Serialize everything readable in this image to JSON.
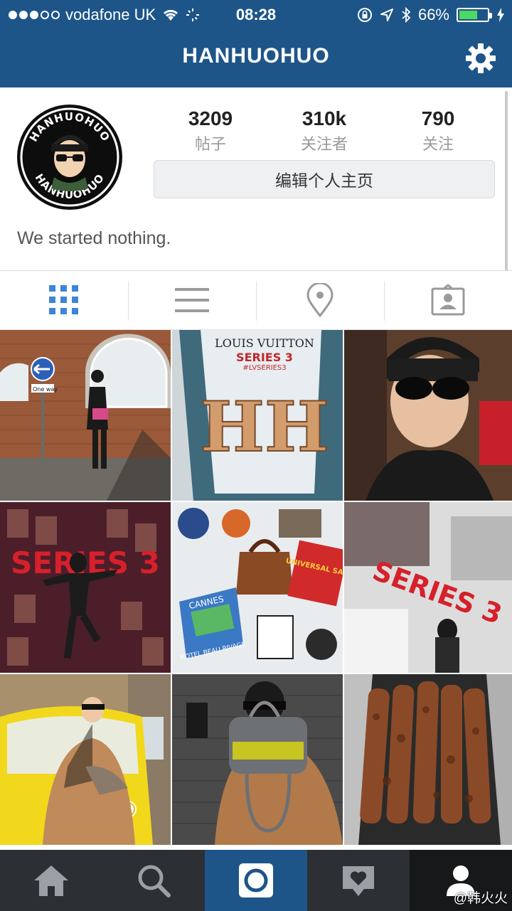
{
  "status_bar": {
    "carrier": "vodafone UK",
    "time": "08:28",
    "battery_pct": "66%",
    "battery_level": 0.66,
    "signal_dots_filled": 3,
    "signal_dots_total": 5
  },
  "header": {
    "title": "HANHUOHUO",
    "accent": "#1d5589"
  },
  "profile": {
    "avatar_text_top": "HANHUOHUO",
    "avatar_text_bottom": "HANHUOHUO",
    "stats": [
      {
        "value": "3209",
        "label": "帖子"
      },
      {
        "value": "310k",
        "label": "关注者"
      },
      {
        "value": "790",
        "label": "关注"
      }
    ],
    "edit_button": "编辑个人主页",
    "bio": "We started nothing."
  },
  "tabs": [
    {
      "icon": "grid-icon",
      "active": true
    },
    {
      "icon": "list-icon",
      "active": false
    },
    {
      "icon": "location-pin-icon",
      "active": false
    },
    {
      "icon": "tagged-photos-icon",
      "active": false
    }
  ],
  "grid": {
    "photos": [
      {
        "caption": "",
        "sign": "One way"
      },
      {
        "caption": "LOUIS VUITTON",
        "sub": "SERIES 3",
        "tag": "#LVSERIES3",
        "letters": "HH"
      },
      {
        "caption": ""
      },
      {
        "caption": "SERIES 3"
      },
      {
        "caption": "CANNES",
        "sub": "HOTEL BEAU RIVAGE",
        "sale": "UNIVERSAL SALE"
      },
      {
        "caption": "SERIES 3"
      },
      {
        "caption": ""
      },
      {
        "caption": ""
      },
      {
        "caption": ""
      }
    ]
  },
  "bottom_nav": [
    {
      "icon": "home-icon"
    },
    {
      "icon": "search-icon"
    },
    {
      "icon": "camera-icon"
    },
    {
      "icon": "activity-heart-icon"
    },
    {
      "icon": "profile-icon"
    }
  ],
  "watermark": "@韩火火"
}
